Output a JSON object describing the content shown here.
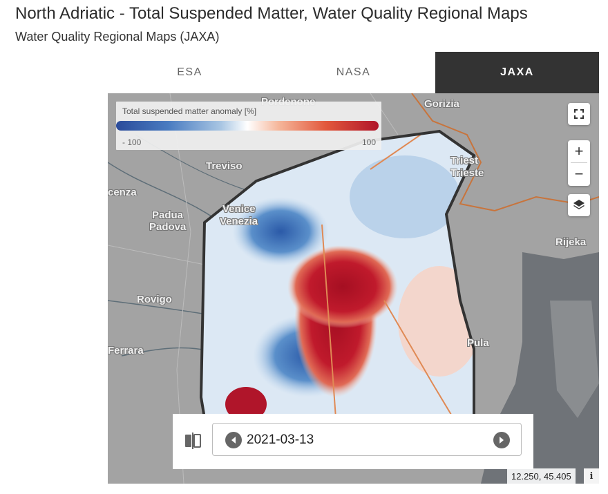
{
  "header": {
    "title": "North Adriatic - Total Suspended Matter, Water Quality Regional Maps",
    "subtitle": "Water Quality Regional Maps (JAXA)"
  },
  "tabs": [
    {
      "label": "ESA",
      "active": false
    },
    {
      "label": "NASA",
      "active": false
    },
    {
      "label": "JAXA",
      "active": true
    }
  ],
  "legend": {
    "title": "Total suspended matter anomaly [%]",
    "min_label": "- 100",
    "max_label": "100",
    "colors": [
      "#2b4b9a",
      "#ffffff",
      "#b0152a"
    ]
  },
  "map": {
    "labels": {
      "pordenone": "Pordenone",
      "gorizia": "Gorizia",
      "trieste_1": "Triest",
      "trieste_2": "Trieste",
      "treviso": "Treviso",
      "vicenza": "cenza",
      "padua_1": "Padua",
      "padua_2": "Padova",
      "venice_1": "Venice",
      "venice_2": "Venezia",
      "rijeka": "Rijeka",
      "rovigo": "Rovigo",
      "pula": "Pula",
      "ferrara": "Ferrara"
    },
    "controls": {
      "fullscreen_icon": "fullscreen-icon",
      "zoom_in": "+",
      "zoom_out": "−",
      "layers_icon": "layers-icon"
    },
    "coordinates": "12.250, 45.405",
    "info": "i"
  },
  "date_picker": {
    "value": "2021-03-13",
    "compare_icon": "compare-icon",
    "prev_icon": "chevron-left-icon",
    "next_icon": "chevron-right-icon"
  }
}
